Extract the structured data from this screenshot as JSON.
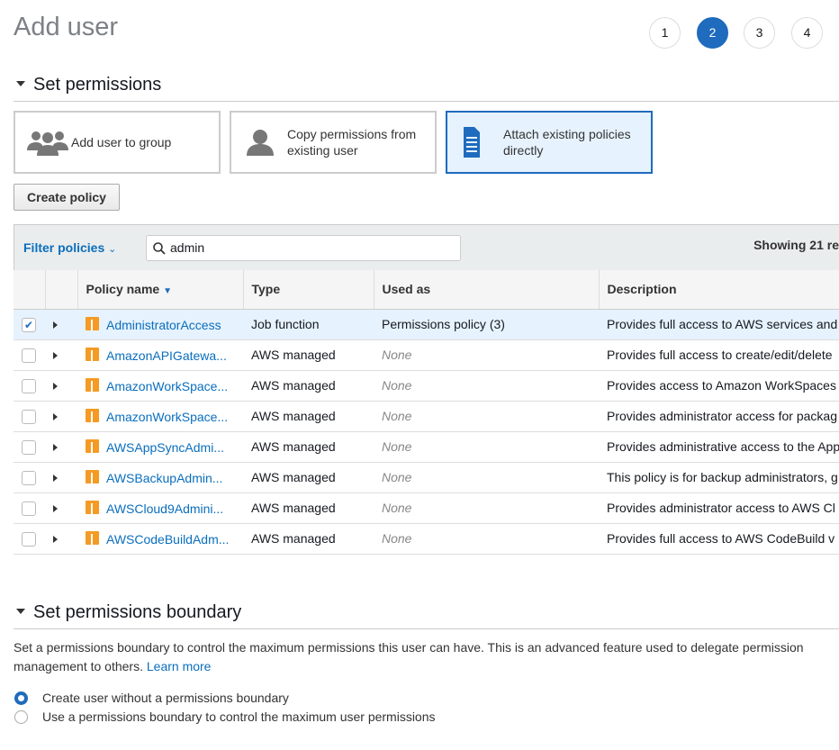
{
  "page": {
    "title": "Add user"
  },
  "steps": [
    {
      "label": "1",
      "active": false
    },
    {
      "label": "2",
      "active": true
    },
    {
      "label": "3",
      "active": false
    },
    {
      "label": "4",
      "active": false
    }
  ],
  "set_permissions": {
    "heading": "Set permissions",
    "options": [
      {
        "label": "Add user to group",
        "icon": "users-group-icon",
        "selected": false
      },
      {
        "label": "Copy permissions from existing user",
        "icon": "user-icon",
        "selected": false
      },
      {
        "label": "Attach existing policies directly",
        "icon": "document-icon",
        "selected": true
      }
    ],
    "create_policy_label": "Create policy",
    "filter_label": "Filter policies",
    "search_value": "admin",
    "showing_text": "Showing 21 re",
    "columns": [
      "Policy name",
      "Type",
      "Used as",
      "Description"
    ],
    "rows": [
      {
        "checked": true,
        "name": "AdministratorAccess",
        "type": "Job function",
        "used_as": "Permissions policy (3)",
        "description": "Provides full access to AWS services and"
      },
      {
        "checked": false,
        "name": "AmazonAPIGatewa...",
        "type": "AWS managed",
        "used_as": "None",
        "description": "Provides full access to create/edit/delete"
      },
      {
        "checked": false,
        "name": "AmazonWorkSpace...",
        "type": "AWS managed",
        "used_as": "None",
        "description": "Provides access to Amazon WorkSpaces"
      },
      {
        "checked": false,
        "name": "AmazonWorkSpace...",
        "type": "AWS managed",
        "used_as": "None",
        "description": "Provides administrator access for packag"
      },
      {
        "checked": false,
        "name": "AWSAppSyncAdmi...",
        "type": "AWS managed",
        "used_as": "None",
        "description": "Provides administrative access to the App"
      },
      {
        "checked": false,
        "name": "AWSBackupAdmin...",
        "type": "AWS managed",
        "used_as": "None",
        "description": "This policy is for backup administrators, g"
      },
      {
        "checked": false,
        "name": "AWSCloud9Admini...",
        "type": "AWS managed",
        "used_as": "None",
        "description": "Provides administrator access to AWS Cl"
      },
      {
        "checked": false,
        "name": "AWSCodeBuildAdm...",
        "type": "AWS managed",
        "used_as": "None",
        "description": "Provides full access to AWS CodeBuild v"
      }
    ]
  },
  "boundary": {
    "heading": "Set permissions boundary",
    "description": "Set a permissions boundary to control the maximum permissions this user can have. This is an advanced feature used to delegate permission management to others.",
    "learn_more": "Learn more",
    "options": [
      {
        "label": "Create user without a permissions boundary",
        "selected": true
      },
      {
        "label": "Use a permissions boundary to control the maximum user permissions",
        "selected": false
      }
    ]
  },
  "colors": {
    "accent": "#1f6bbd",
    "link": "#0a6ebd",
    "policy_icon": "#f59a23",
    "selected_bg": "#e6f2fd"
  }
}
